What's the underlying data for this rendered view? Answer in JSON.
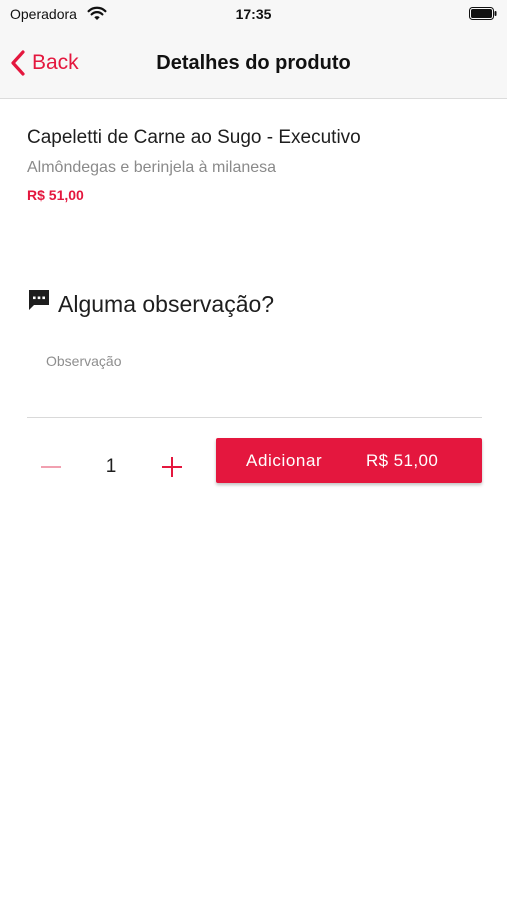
{
  "status_bar": {
    "carrier": "Operadora",
    "time": "17:35",
    "wifi_icon": "wifi-icon",
    "battery_icon": "battery-icon"
  },
  "nav": {
    "back_label": "Back",
    "back_icon": "chevron-left-icon",
    "title": "Detalhes do produto"
  },
  "product": {
    "name": "Capeletti de Carne ao Sugo - Executivo",
    "description": "Almôndegas e berinjela à milanesa",
    "price": "R$ 51,00"
  },
  "observation": {
    "icon": "comment-icon",
    "title": "Alguma observação?",
    "placeholder": "Observação",
    "value": ""
  },
  "quantity": {
    "value": "1",
    "minus_icon": "minus-icon",
    "plus_icon": "plus-icon"
  },
  "add_button": {
    "label": "Adicionar",
    "price": "R$ 51,00"
  },
  "colors": {
    "accent": "#e4173e",
    "nav_background": "#f7f7f7",
    "muted_text": "#8a8a8a"
  }
}
